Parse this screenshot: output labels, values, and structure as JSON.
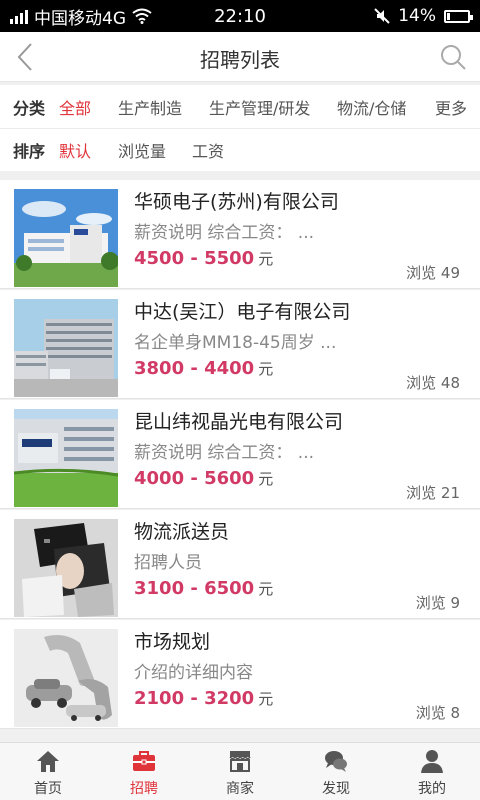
{
  "status": {
    "carrier": "中国移动4G",
    "time": "22:10",
    "battery": "14%",
    "battery_level": 0.14
  },
  "header": {
    "title": "招聘列表"
  },
  "filters": {
    "category_label": "分类",
    "categories": [
      {
        "label": "全部",
        "active": true
      },
      {
        "label": "生产制造",
        "active": false
      },
      {
        "label": "生产管理/研发",
        "active": false
      },
      {
        "label": "物流/仓储",
        "active": false
      },
      {
        "label": "更多",
        "active": false
      }
    ],
    "sort_label": "排序",
    "sorts": [
      {
        "label": "默认",
        "active": true
      },
      {
        "label": "浏览量",
        "active": false
      },
      {
        "label": "工资",
        "active": false
      }
    ]
  },
  "jobs": [
    {
      "title": "华硕电子(苏州)有限公司",
      "desc": "薪资说明 综合工资：  ...",
      "salary": "4500 - 5500",
      "unit": "元",
      "views": "浏览 49",
      "image": "building-asus"
    },
    {
      "title": "中达(吴江）电子有限公司",
      "desc": "名企单身MM18-45周岁 ...",
      "salary": "3800 - 4400",
      "unit": "元",
      "views": "浏览 48",
      "image": "building-delta"
    },
    {
      "title": "昆山纬视晶光电有限公司",
      "desc": "薪资说明 综合工资：  ...",
      "salary": "4000 - 5600",
      "unit": "元",
      "views": "浏览 21",
      "image": "building-wistron"
    },
    {
      "title": "物流派送员",
      "desc": "招聘人员",
      "salary": "3100 - 6500",
      "unit": "元",
      "views": "浏览 9",
      "image": "collage-face"
    },
    {
      "title": "市场规划",
      "desc": "介绍的详细内容",
      "salary": "2100 - 3200",
      "unit": "元",
      "views": "浏览 8",
      "image": "car-wrench"
    }
  ],
  "tabs": [
    {
      "label": "首页",
      "icon": "home-icon",
      "active": false
    },
    {
      "label": "招聘",
      "icon": "briefcase-icon",
      "active": true
    },
    {
      "label": "商家",
      "icon": "shop-icon",
      "active": false
    },
    {
      "label": "发现",
      "icon": "chat-icon",
      "active": false
    },
    {
      "label": "我的",
      "icon": "user-icon",
      "active": false
    }
  ],
  "colors": {
    "accent": "#e0343b",
    "salary": "#d23a66",
    "muted": "#888888"
  }
}
